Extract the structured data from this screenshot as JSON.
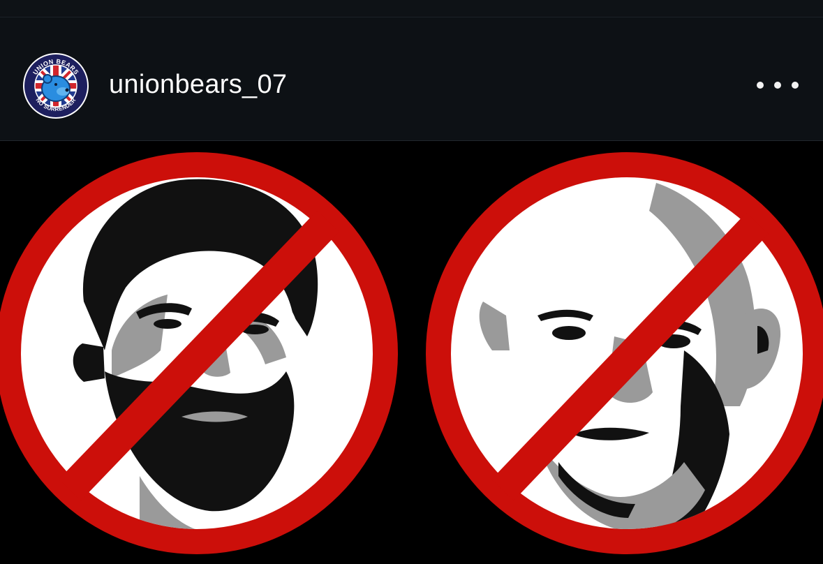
{
  "post": {
    "username": "unionbears_07",
    "avatar": {
      "icon": "union-bears-badge-icon",
      "top_text": "UNION BEARS",
      "bottom_text": "NO SURRENDER"
    },
    "more_icon": "more-options-icon"
  },
  "image": {
    "description_icon": "prohibition-sign-icon",
    "colors": {
      "ring": "#cc0f0a",
      "fill": "#ffffff",
      "background": "#000000",
      "shade": "#9a9a9a"
    }
  }
}
